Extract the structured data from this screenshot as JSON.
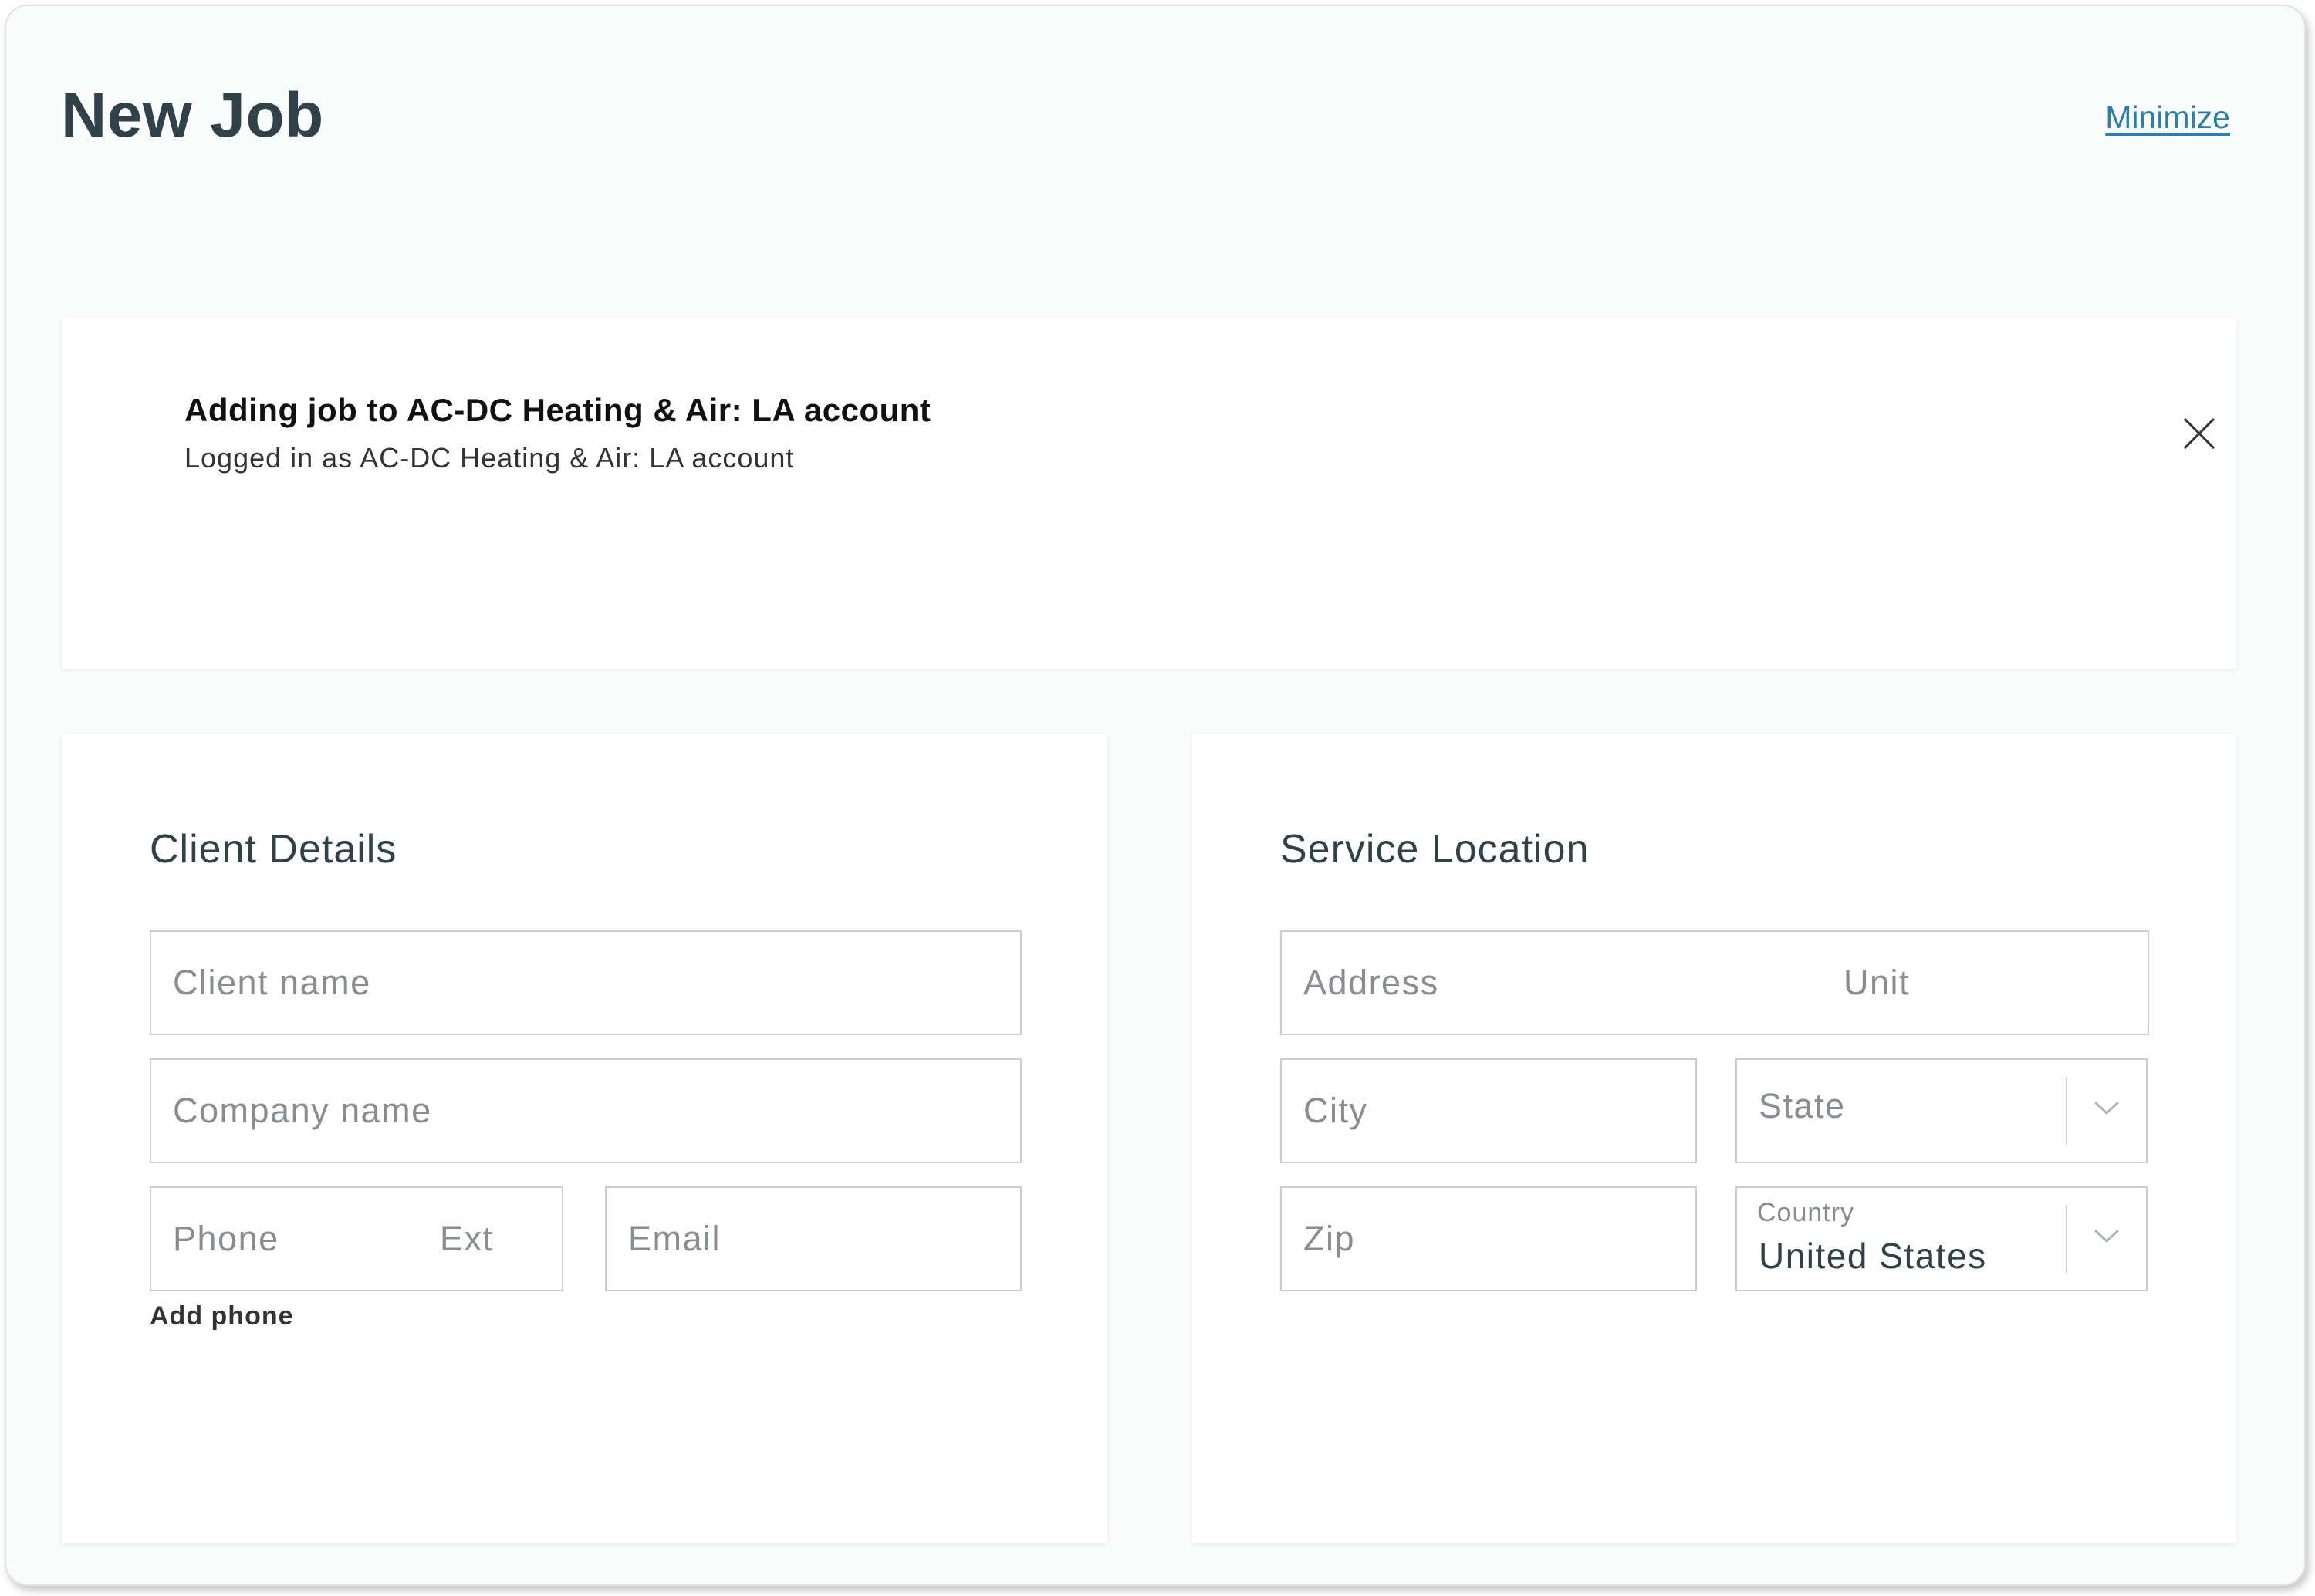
{
  "header": {
    "title": "New Job",
    "minimize_label": "Minimize"
  },
  "banner": {
    "title": "Adding job to AC-DC Heating & Air: LA account",
    "subtitle": "Logged in as AC-DC Heating & Air: LA account",
    "close_icon": "close-icon"
  },
  "client_details": {
    "title": "Client Details",
    "client_name_placeholder": "Client name",
    "company_name_placeholder": "Company name",
    "phone_placeholder": "Phone",
    "ext_placeholder": "Ext",
    "email_placeholder": "Email",
    "add_phone_label": "Add phone"
  },
  "service_location": {
    "title": "Service Location",
    "address_placeholder": "Address",
    "unit_placeholder": "Unit",
    "city_placeholder": "City",
    "state_placeholder": "State",
    "zip_placeholder": "Zip",
    "country_label": "Country",
    "country_value": "United States",
    "dropdown_icon": "chevron-down-icon"
  },
  "colors": {
    "heading": "#2f4149",
    "link": "#2b7fb0",
    "border": "#c9cdd0",
    "placeholder": "#8a8d90"
  }
}
